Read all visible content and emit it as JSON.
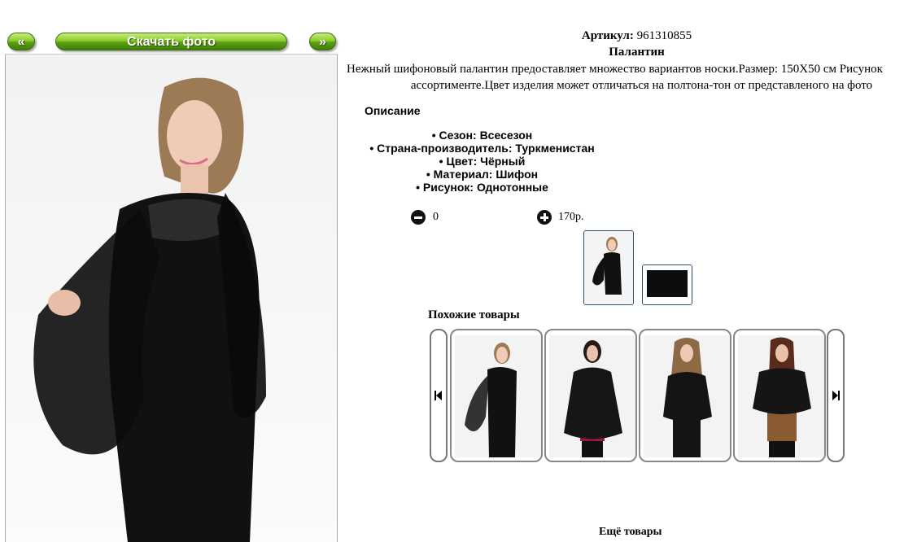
{
  "gallery": {
    "prev_label": "«",
    "download_label": "Скачать фото",
    "next_label": "»"
  },
  "product": {
    "article_label": "Артикул:",
    "article_value": "961310855",
    "title": "Палантин",
    "description_line1": "Нежный шифоновый палантин предоставляет множество вариантов носки.Размер: 150Х50 см Рисунок",
    "description_line2": "ассортименте.Цвет изделия может отличаться на полтона-тон от представленого на фото",
    "description_heading": "Описание",
    "properties": [
      "• Сезон: Всесезон",
      "• Страна-производитель: Туркменистан",
      "• Цвет: Чёрный",
      "• Материал: Шифон",
      "• Рисунок: Однотонные"
    ],
    "quantity": "0",
    "price": "170р."
  },
  "similar": {
    "heading": "Похожие товары",
    "items": [
      {
        "top": "#111111",
        "accent": "#111111"
      },
      {
        "top": "#161616",
        "accent": "#a0124a"
      },
      {
        "top": "#141414",
        "accent": "#141414"
      },
      {
        "top": "#151515",
        "accent": "#8a5a32"
      }
    ]
  },
  "more_heading": "Ещё товары"
}
